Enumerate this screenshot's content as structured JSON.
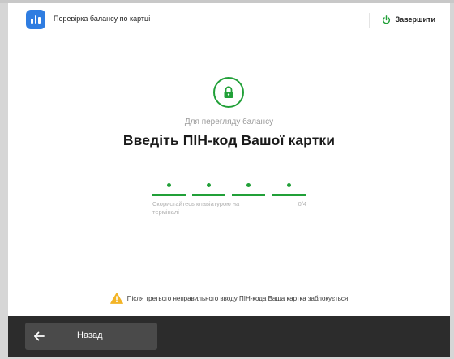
{
  "header": {
    "title": "Перевірка балансу по картці",
    "app_icon": "bar-chart-icon",
    "exit_label": "Завершити",
    "exit_icon": "power-icon"
  },
  "main": {
    "lock_icon": "lock-icon",
    "subtitle": "Для перегляду балансу",
    "title": "Введіть ПІН-код Вашої картки",
    "pin": {
      "length": 4,
      "entered": 4,
      "hint": "Скористайтесь клавіатурою на терміналі",
      "counter": "0/4"
    },
    "warning": {
      "icon": "warning-icon",
      "text": "Після третього неправильного вводу ПІН-кода Ваша картка заблокується"
    }
  },
  "footer": {
    "back_label": "Назад",
    "back_icon": "arrow-left-icon"
  },
  "colors": {
    "accent": "#21a038",
    "brand": "#2f7de1",
    "warning": "#f3b426",
    "footer_bg": "#2c2c2c",
    "button_bg": "#4a4a4a"
  }
}
